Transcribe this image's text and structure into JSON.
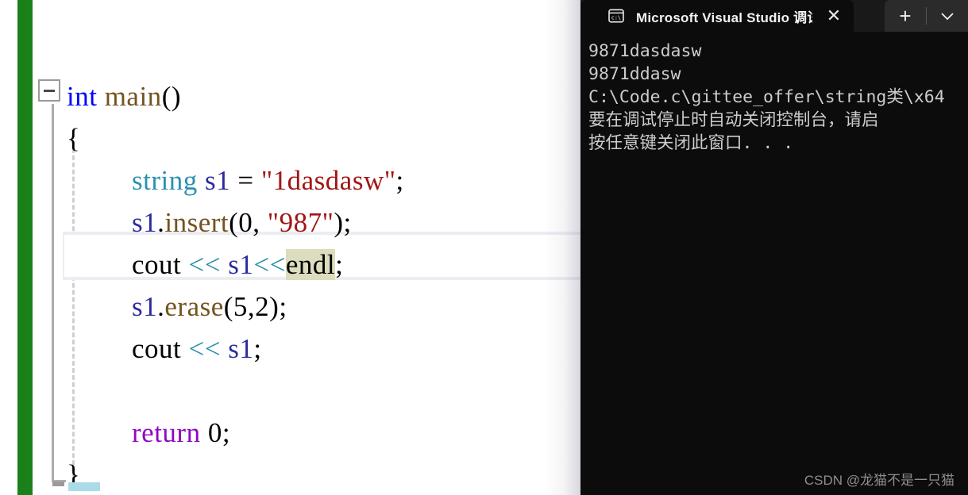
{
  "editor": {
    "name": "visual-studio-code-editor",
    "change_bar_color": "#1a8019",
    "background": "#ffffff",
    "collapse_state": "expanded",
    "current_line_number": 5,
    "reference_highlight_token": "endl",
    "lines": [
      {
        "indent": 0,
        "tokens": [
          {
            "text": "int",
            "cls": "t-kw"
          },
          {
            "text": " ",
            "cls": "t-plain"
          },
          {
            "text": "main",
            "cls": "t-fn"
          },
          {
            "text": "()",
            "cls": "t-plain"
          }
        ]
      },
      {
        "indent": 0,
        "tokens": [
          {
            "text": "{",
            "cls": "t-plain"
          }
        ]
      },
      {
        "indent": 1,
        "tokens": [
          {
            "text": "string",
            "cls": "t-type"
          },
          {
            "text": " ",
            "cls": "t-plain"
          },
          {
            "text": "s1",
            "cls": "t-var"
          },
          {
            "text": " = ",
            "cls": "t-plain"
          },
          {
            "text": "\"1dasdasw\"",
            "cls": "t-str"
          },
          {
            "text": ";",
            "cls": "t-plain"
          }
        ]
      },
      {
        "indent": 1,
        "tokens": [
          {
            "text": "s1",
            "cls": "t-var"
          },
          {
            "text": ".",
            "cls": "t-plain"
          },
          {
            "text": "insert",
            "cls": "t-fn"
          },
          {
            "text": "(",
            "cls": "t-plain"
          },
          {
            "text": "0",
            "cls": "t-num"
          },
          {
            "text": ", ",
            "cls": "t-plain"
          },
          {
            "text": "\"987\"",
            "cls": "t-str"
          },
          {
            "text": ");",
            "cls": "t-plain"
          }
        ]
      },
      {
        "indent": 1,
        "current": true,
        "tokens": [
          {
            "text": "cout",
            "cls": "t-plain"
          },
          {
            "text": " ",
            "cls": "t-plain"
          },
          {
            "text": "<<",
            "cls": "t-op"
          },
          {
            "text": " ",
            "cls": "t-plain"
          },
          {
            "text": "s1",
            "cls": "t-var"
          },
          {
            "text": "<<",
            "cls": "t-op"
          },
          {
            "text": "endl",
            "cls": "t-plain",
            "hl": true
          },
          {
            "text": ";",
            "cls": "t-plain"
          }
        ]
      },
      {
        "indent": 1,
        "tokens": [
          {
            "text": "s1",
            "cls": "t-var"
          },
          {
            "text": ".",
            "cls": "t-plain"
          },
          {
            "text": "erase",
            "cls": "t-fn"
          },
          {
            "text": "(",
            "cls": "t-plain"
          },
          {
            "text": "5",
            "cls": "t-num"
          },
          {
            "text": ",",
            "cls": "t-plain"
          },
          {
            "text": "2",
            "cls": "t-num"
          },
          {
            "text": ");",
            "cls": "t-plain"
          }
        ]
      },
      {
        "indent": 1,
        "tokens": [
          {
            "text": "cout",
            "cls": "t-plain"
          },
          {
            "text": " ",
            "cls": "t-plain"
          },
          {
            "text": "<<",
            "cls": "t-op"
          },
          {
            "text": " ",
            "cls": "t-plain"
          },
          {
            "text": "s1",
            "cls": "t-var"
          },
          {
            "text": ";",
            "cls": "t-plain"
          }
        ]
      },
      {
        "indent": 1,
        "tokens": []
      },
      {
        "indent": 1,
        "tokens": [
          {
            "text": "return",
            "cls": "t-kw2"
          },
          {
            "text": " ",
            "cls": "t-plain"
          },
          {
            "text": "0",
            "cls": "t-num"
          },
          {
            "text": ";",
            "cls": "t-plain"
          }
        ]
      },
      {
        "indent": 0,
        "tokens": [
          {
            "text": "}",
            "cls": "t-plain"
          }
        ]
      }
    ]
  },
  "terminal": {
    "tab": {
      "icon": "console-cmd-icon",
      "title": "Microsoft Visual Studio 调试控",
      "close_label": "✕"
    },
    "controls": {
      "new_tab_label": "+",
      "dropdown_label": "⌄"
    },
    "output_lines": [
      "9871dasdasw",
      "9871ddasw",
      "C:\\Code.c\\gittee_offer\\string类\\x64",
      "要在调试停止时自动关闭控制台，请启",
      "按任意键关闭此窗口. . ."
    ],
    "watermark": "CSDN @龙猫不是一只猫",
    "background": "#0c0c0c",
    "text_color": "#cccccc"
  }
}
